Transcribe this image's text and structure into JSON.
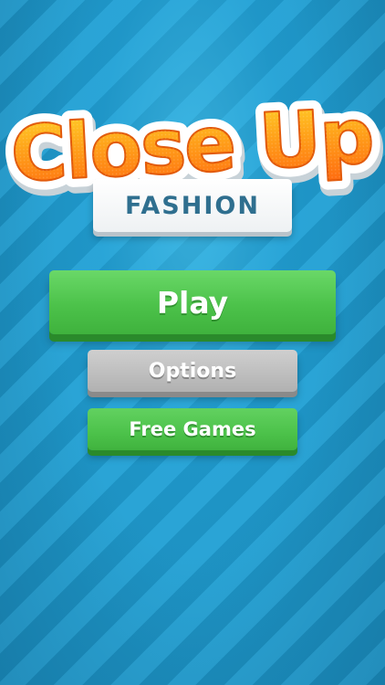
{
  "logo": {
    "title": "Close Up",
    "subtitle": "FASHION"
  },
  "menu": {
    "play_label": "Play",
    "options_label": "Options",
    "free_games_label": "Free Games"
  },
  "colors": {
    "background": "#1f93c4",
    "title_orange": "#ff7a12",
    "title_yellow": "#ffc21a",
    "subtitle_text": "#2f6f8f",
    "play_green": "#4cc24a",
    "options_gray": "#bdbdbd"
  }
}
